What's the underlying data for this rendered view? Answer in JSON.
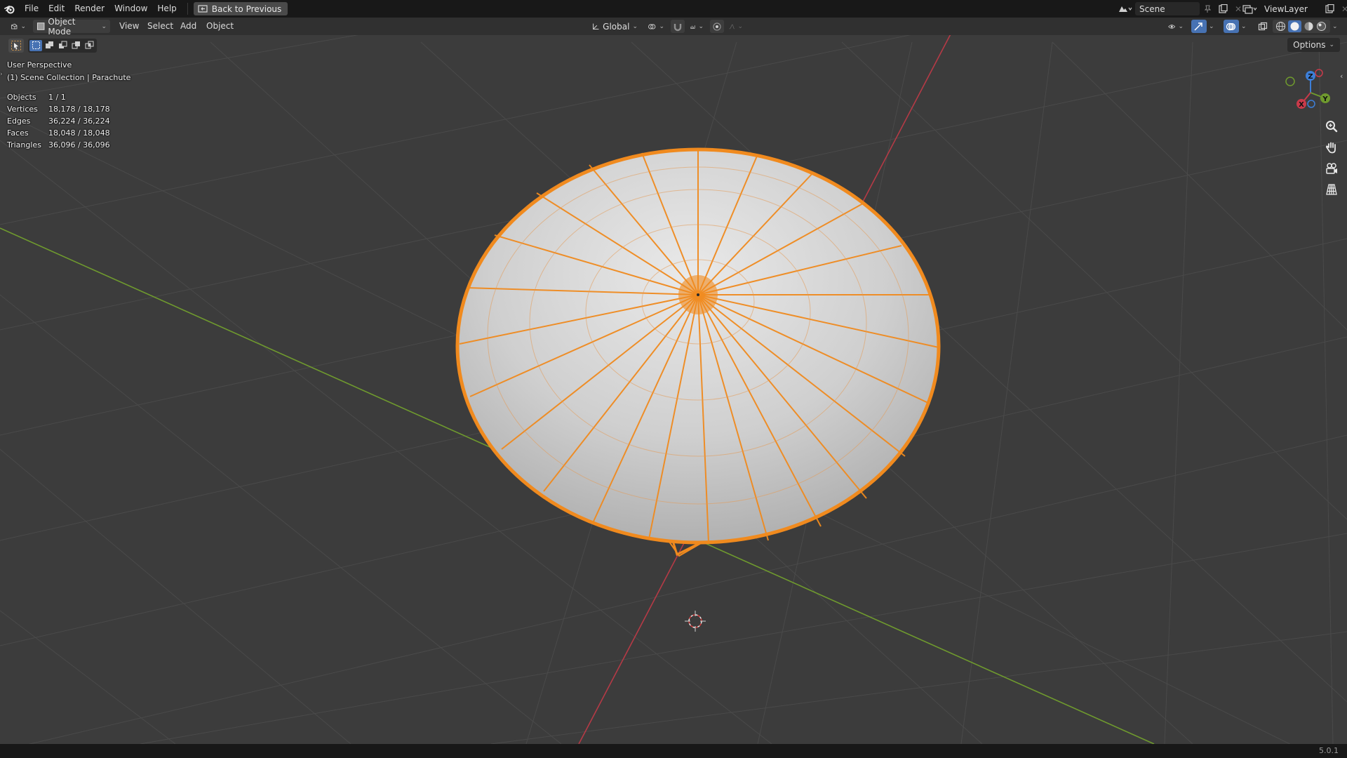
{
  "menubar": {
    "items": [
      "File",
      "Edit",
      "Render",
      "Window",
      "Help"
    ],
    "back_button": "Back to Previous",
    "scene_name": "Scene",
    "view_layer_name": "ViewLayer"
  },
  "header": {
    "mode": "Object Mode",
    "menus": [
      "View",
      "Select",
      "Add",
      "Object"
    ],
    "transform_orientation": "Global"
  },
  "viewport": {
    "perspective_label": "User Perspective",
    "collection_label": "(1) Scene Collection | Parachute",
    "options_label": "Options",
    "stats": [
      {
        "label": "Objects",
        "value": "1 / 1"
      },
      {
        "label": "Vertices",
        "value": "18,178 / 18,178"
      },
      {
        "label": "Edges",
        "value": "36,224 / 36,224"
      },
      {
        "label": "Faces",
        "value": "18,048 / 18,048"
      },
      {
        "label": "Triangles",
        "value": "36,096 / 36,096"
      }
    ],
    "gizmo_axes": {
      "x": "X",
      "y": "Y",
      "z": "Z"
    }
  },
  "statusbar": {
    "version": "5.0.1"
  },
  "colors": {
    "selection_orange": "#f08a1e",
    "x_axis": "#c93a4a",
    "y_axis": "#6f9a2e",
    "z_axis": "#3d7fd8",
    "active_blue": "#4772b3"
  }
}
